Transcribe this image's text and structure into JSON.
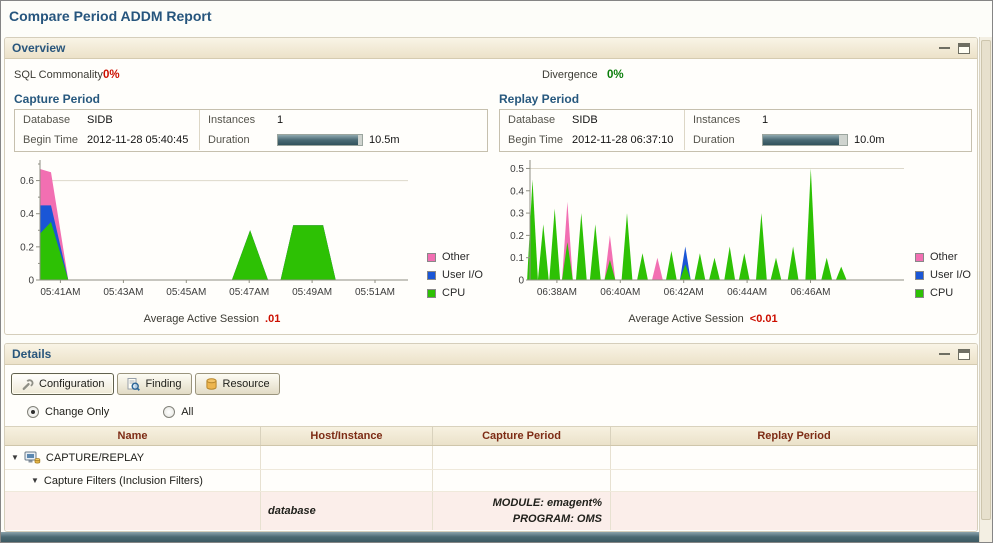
{
  "page": {
    "title": "Compare Period ADDM Report"
  },
  "overview": {
    "title": "Overview",
    "sql_commonality": {
      "label": "SQL Commonality",
      "value": "0%"
    },
    "divergence": {
      "label": "Divergence",
      "value": "0%"
    },
    "capture": {
      "heading": "Capture Period",
      "database_label": "Database",
      "database_value": "SIDB",
      "instances_label": "Instances",
      "instances_value": "1",
      "begin_label": "Begin Time",
      "begin_value": "2012-11-28 05:40:45",
      "duration_label": "Duration",
      "duration_value": "10.5m",
      "duration_pct": 95,
      "avg_label": "Average Active Session",
      "avg_value": ".01"
    },
    "replay": {
      "heading": "Replay Period",
      "database_label": "Database",
      "database_value": "SIDB",
      "instances_label": "Instances",
      "instances_value": "1",
      "begin_label": "Begin Time",
      "begin_value": "2012-11-28 06:37:10",
      "duration_label": "Duration",
      "duration_value": "10.0m",
      "duration_pct": 91,
      "avg_label": "Average Active Session",
      "avg_value": "<0.01"
    },
    "legend": [
      {
        "label": "Other",
        "color": "#f26fb2"
      },
      {
        "label": "User I/O",
        "color": "#1a56d6"
      },
      {
        "label": "CPU",
        "color": "#2dc104"
      }
    ]
  },
  "chart_colors": {
    "cpu": "#2dc104",
    "userio": "#1a56d6",
    "other": "#f26fb2"
  },
  "chart_data": [
    {
      "type": "area",
      "title": "Capture Period Active Sessions",
      "xlabel": "",
      "ylabel": "Average Active Sessions",
      "xlim": [
        0,
        11.7
      ],
      "ylim": [
        0,
        0.7
      ],
      "x_tick_pos": [
        0.65,
        2.65,
        4.65,
        6.65,
        8.65,
        10.65
      ],
      "x_tick_labels": [
        "05:41AM",
        "05:43AM",
        "05:45AM",
        "05:47AM",
        "05:49AM",
        "05:51AM"
      ],
      "y_ticks": [
        0,
        0.2,
        0.4,
        0.6
      ],
      "y_minor": [
        0.1,
        0.3,
        0.5,
        0.7
      ],
      "gridline_at": 0.6,
      "legend_position": "right",
      "x": [
        0,
        0.35,
        0.9,
        6.1,
        6.68,
        7.25,
        7.65,
        8.05,
        9.0,
        9.4,
        11.7
      ],
      "series": [
        {
          "name": "CPU",
          "color_key": "cpu",
          "values": [
            0.28,
            0.35,
            0,
            0,
            0.3,
            0,
            0,
            0.33,
            0.33,
            0,
            0
          ]
        },
        {
          "name": "User I/O",
          "color_key": "userio",
          "values": [
            0.17,
            0.1,
            0,
            0,
            0,
            0,
            0,
            0,
            0,
            0,
            0
          ]
        },
        {
          "name": "Other",
          "color_key": "other",
          "values": [
            0.22,
            0.2,
            0,
            0,
            0,
            0,
            0,
            0,
            0,
            0,
            0
          ]
        }
      ]
    },
    {
      "type": "area-spikes",
      "title": "Replay Period Active Sessions",
      "xlabel": "",
      "ylabel": "Average Active Sessions",
      "xlim": [
        0,
        11.8
      ],
      "ylim": [
        0,
        0.52
      ],
      "x_tick_pos": [
        0.85,
        2.85,
        4.85,
        6.85,
        8.85
      ],
      "x_tick_labels": [
        "06:38AM",
        "06:40AM",
        "06:42AM",
        "06:44AM",
        "06:46AM"
      ],
      "y_ticks": [
        0,
        0.1,
        0.2,
        0.3,
        0.4,
        0.5
      ],
      "gridline_at": 0.5,
      "legend_position": "right",
      "spike_halfwidth": 0.17,
      "spikes": [
        {
          "x": 0.08,
          "h": 0.45,
          "c": "cpu"
        },
        {
          "x": 0.42,
          "h": 0.25,
          "c": "cpu"
        },
        {
          "x": 0.78,
          "h": 0.32,
          "c": "cpu"
        },
        {
          "x": 1.18,
          "h": 0.35,
          "c": "other"
        },
        {
          "x": 1.18,
          "h": 0.17,
          "c": "cpu"
        },
        {
          "x": 1.62,
          "h": 0.3,
          "c": "cpu"
        },
        {
          "x": 2.06,
          "h": 0.25,
          "c": "cpu"
        },
        {
          "x": 2.52,
          "h": 0.2,
          "c": "other"
        },
        {
          "x": 2.52,
          "h": 0.09,
          "c": "cpu"
        },
        {
          "x": 3.06,
          "h": 0.3,
          "c": "cpu"
        },
        {
          "x": 3.55,
          "h": 0.12,
          "c": "cpu"
        },
        {
          "x": 4.02,
          "h": 0.1,
          "c": "other"
        },
        {
          "x": 4.46,
          "h": 0.13,
          "c": "cpu"
        },
        {
          "x": 4.9,
          "h": 0.15,
          "c": "userio"
        },
        {
          "x": 4.9,
          "h": 0.07,
          "c": "cpu"
        },
        {
          "x": 5.36,
          "h": 0.12,
          "c": "cpu"
        },
        {
          "x": 5.82,
          "h": 0.1,
          "c": "cpu"
        },
        {
          "x": 6.3,
          "h": 0.15,
          "c": "cpu"
        },
        {
          "x": 6.76,
          "h": 0.12,
          "c": "cpu"
        },
        {
          "x": 7.3,
          "h": 0.3,
          "c": "cpu"
        },
        {
          "x": 7.76,
          "h": 0.1,
          "c": "cpu"
        },
        {
          "x": 8.3,
          "h": 0.15,
          "c": "cpu"
        },
        {
          "x": 8.86,
          "h": 0.5,
          "c": "cpu"
        },
        {
          "x": 9.36,
          "h": 0.1,
          "c": "cpu"
        },
        {
          "x": 9.82,
          "h": 0.06,
          "c": "cpu"
        }
      ]
    }
  ],
  "details": {
    "title": "Details",
    "tabs": [
      {
        "label": "Configuration",
        "active": true
      },
      {
        "label": "Finding",
        "active": false
      },
      {
        "label": "Resource",
        "active": false
      }
    ],
    "filter": {
      "change_only": "Change Only",
      "all": "All",
      "selected": "Change Only"
    },
    "tree": {
      "expanded_glyph": "▼"
    },
    "table": {
      "headers": [
        "Name",
        "Host/Instance",
        "Capture Period",
        "Replay Period"
      ],
      "rows": [
        {
          "name": "CAPTURE/REPLAY"
        },
        {
          "name": "Capture Filters (Inclusion Filters)"
        },
        {
          "host_instance": "database",
          "capture_period": [
            "MODULE: emagent%",
            "PROGRAM: OMS"
          ],
          "replay_period": ""
        }
      ]
    }
  }
}
